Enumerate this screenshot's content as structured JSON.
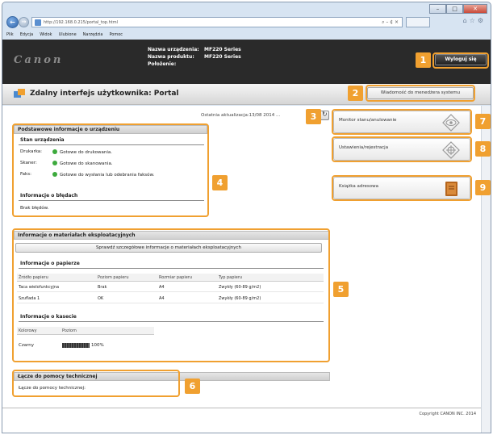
{
  "browser": {
    "url": "http://192.168.0.215/portal_top.html",
    "addr_tools": "⌕ – ¢ ×",
    "back_glyph": "←",
    "fwd_glyph": "→",
    "chrome_icons": "⌂☆⚙",
    "menu": [
      "Plik",
      "Edycja",
      "Widok",
      "Ulubione",
      "Narzędzia",
      "Pomoc"
    ],
    "window_buttons": [
      "–",
      "□",
      "✕"
    ]
  },
  "header": {
    "logo_text": "Canon",
    "device_name_label": "Nazwa urządzenia:",
    "device_name": "MF220 Series",
    "product_name_label": "Nazwa produktu:",
    "product_name": "MF220 Series",
    "location_label": "Położenie:",
    "location": "",
    "logout_label": "Wyloguj się"
  },
  "titlebar": {
    "title": "Zdalny interfejs użytkownika: Portal",
    "messages_button": "Wiadomość do menedżera systemu"
  },
  "main": {
    "last_updated": "Ostatnia aktualizacja:13/08 2014 ...",
    "basic_info": {
      "heading": "Podstawowe informacje o urządzeniu",
      "status_heading": "Stan urządzenia",
      "status_rows": [
        {
          "label": "Drukarka:",
          "value": "Gotowe do drukowania."
        },
        {
          "label": "Skaner:",
          "value": "Gotowe do skanowania."
        },
        {
          "label": "Faks:",
          "value": "Gotowe do wysłania lub odebrania faksów."
        }
      ],
      "error_heading": "Informacje o błędach",
      "error_text": "Brak błędów."
    },
    "consumables": {
      "heading": "Informacje o materiałach eksploatacyjnych",
      "details_button": "Sprawdź szczegółowe informacje o materiałach eksploatacyjnych",
      "paper_heading": "Informacje o papierze",
      "paper_columns": [
        "Źródło papieru",
        "Poziom papieru",
        "Rozmiar papieru",
        "Typ papieru"
      ],
      "paper_rows": [
        [
          "Taca wielofunkcyjna",
          "Brak",
          "A4",
          "Zwykły (60-89 g/m2)"
        ],
        [
          "Szuflada 1",
          "OK",
          "A4",
          "Zwykły (60-89 g/m2)"
        ]
      ],
      "cartridge_heading": "Informacje o kasecie",
      "cartridge_columns": [
        "Kolorowy",
        "Poziom"
      ],
      "cartridge_color": "Czarny",
      "cartridge_level_text": "100%",
      "cartridge_level": 1.0
    },
    "support": {
      "heading": "Łącze do pomocy technicznej",
      "link_text": "Łącze do pomocy technicznej:"
    },
    "copyright": "Copyright CANON INC. 2014"
  },
  "right_panel": {
    "monitor": "Monitor stanu/anulowanie",
    "settings": "Ustawienia/rejestracja",
    "addressbook": "Książka adresowa"
  },
  "callouts": [
    "1",
    "2",
    "3",
    "4",
    "5",
    "6",
    "7",
    "8",
    "9"
  ],
  "colors": {
    "callout": "#f0a030",
    "status_ok": "#3daa3d",
    "header_bg": "#2a2a2a"
  }
}
